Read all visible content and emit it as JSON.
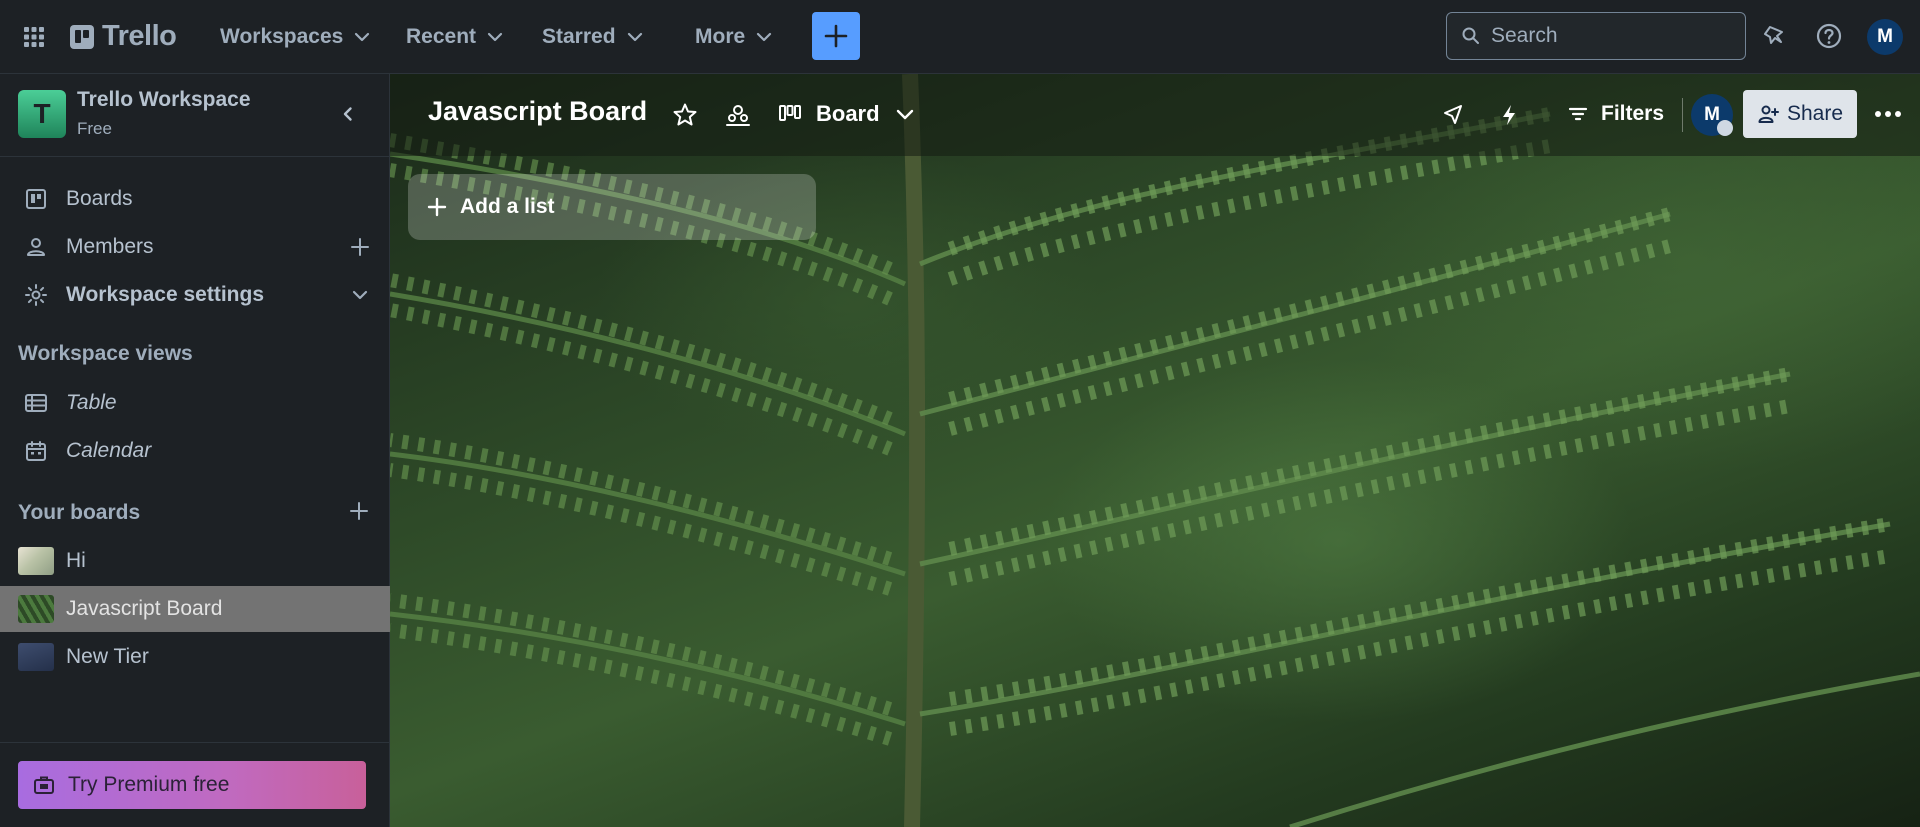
{
  "topnav": {
    "logo_text": "Trello",
    "menus": [
      {
        "label": "Workspaces"
      },
      {
        "label": "Recent"
      },
      {
        "label": "Starred"
      },
      {
        "label": "More"
      }
    ],
    "search_placeholder": "Search",
    "avatar_initial": "M"
  },
  "sidebar": {
    "workspace_logo_letter": "T",
    "workspace_name": "Trello Workspace",
    "workspace_plan": "Free",
    "items": [
      {
        "label": "Boards"
      },
      {
        "label": "Members"
      },
      {
        "label": "Workspace settings"
      }
    ],
    "views_title": "Workspace views",
    "views": [
      {
        "label": "Table"
      },
      {
        "label": "Calendar"
      }
    ],
    "boards_title": "Your boards",
    "boards": [
      {
        "label": "Hi"
      },
      {
        "label": "Javascript Board"
      },
      {
        "label": "New Tier"
      }
    ],
    "premium_label": "Try Premium free"
  },
  "board": {
    "title": "Javascript Board",
    "view_label": "Board",
    "filters_label": "Filters",
    "avatar_initial": "M",
    "share_label": "Share",
    "add_list_label": "Add a list"
  },
  "colors": {
    "create_button": "#579dff",
    "workspace_logo": "#4bce97",
    "active_board_row": "#737373",
    "premium_gradient_start": "#a86ce0",
    "premium_gradient_end": "#c8609a"
  }
}
